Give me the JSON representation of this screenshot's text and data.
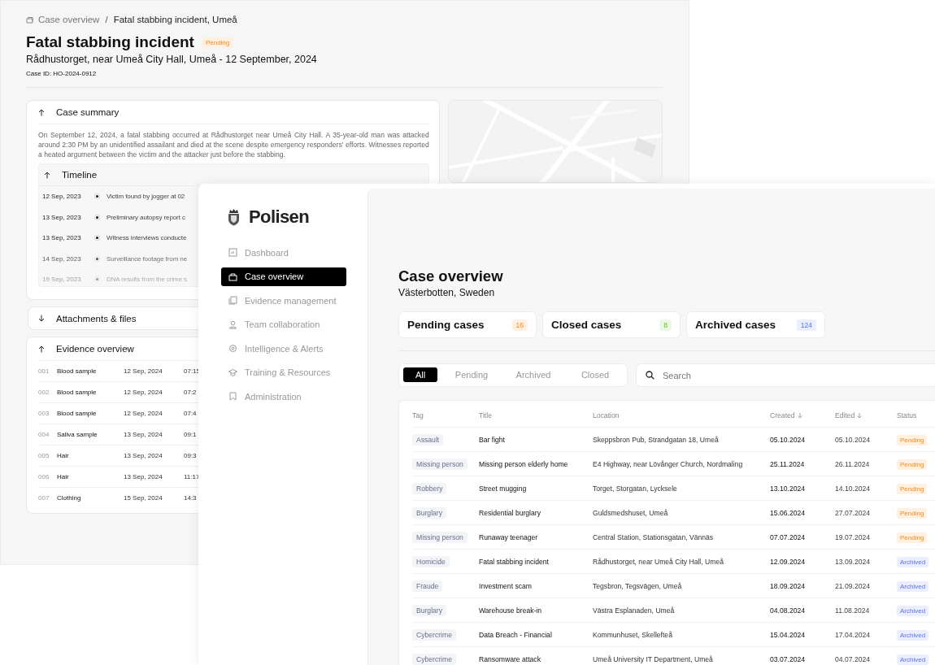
{
  "case_window": {
    "breadcrumb": {
      "parent": "Case overview",
      "separator": "/",
      "current": "Fatal stabbing incident, Umeå"
    },
    "title": "Fatal stabbing incident",
    "status": {
      "label": "Pending",
      "kind": "pending"
    },
    "subtitle": "Rådhustorget, near Umeå City Hall, Umeå - 12 September, 2024",
    "case_id": "Case ID: HO-2024-0912",
    "case_summary": {
      "title": "Case summary",
      "expanded": true,
      "text": "On September 12, 2024, a fatal stabbing occurred at Rådhustorget near Umeå City Hall. A 35-year-old man was attacked around 2:30 PM by an unidentified assailant and died at the scene despite emergency responders' efforts. Witnesses reported a heated argument between the victim and the attacker just before the stabbing."
    },
    "timeline": {
      "title": "Timeline",
      "expanded": true,
      "events": [
        {
          "date": "12 Sep, 2023",
          "text": "Victim found by jogger at 02"
        },
        {
          "date": "13 Sep, 2023",
          "text": "Preliminary autopsy report c"
        },
        {
          "date": "13 Sep, 2023",
          "text": "Witness interviews conducte"
        },
        {
          "date": "14 Sep, 2023",
          "text": "Surveillance footage from ne"
        },
        {
          "date": "19 Sep, 2023",
          "text": "DNA results from the crime s"
        }
      ]
    },
    "attachments": {
      "title": "Attachments & files",
      "expanded": false
    },
    "evidence": {
      "title": "Evidence overview",
      "expanded": true,
      "rows": [
        {
          "id": "001",
          "name": "Blood sample",
          "date": "12 Sep, 2024",
          "time": "07:15"
        },
        {
          "id": "002",
          "name": "Blood sample",
          "date": "12 Sep, 2024",
          "time": "07:2"
        },
        {
          "id": "003",
          "name": "Blood sample",
          "date": "12 Sep, 2024",
          "time": "07:4"
        },
        {
          "id": "004",
          "name": "Saliva sample",
          "date": "13 Sep, 2024",
          "time": "09:1"
        },
        {
          "id": "005",
          "name": "Hair",
          "date": "13 Sep, 2024",
          "time": "09:3"
        },
        {
          "id": "006",
          "name": "Hair",
          "date": "13 Sep, 2024",
          "time": "11:17"
        },
        {
          "id": "007",
          "name": "Clothing",
          "date": "15 Sep, 2024",
          "time": "14:3"
        }
      ]
    }
  },
  "app_window": {
    "logo": "Polisen",
    "nav": [
      {
        "label": "Dashboard",
        "selected": false
      },
      {
        "label": "Case overview",
        "selected": true
      },
      {
        "label": "Evidence management",
        "selected": false
      },
      {
        "label": "Team collaboration",
        "selected": false
      },
      {
        "label": "Intelligence & Alerts",
        "selected": false
      },
      {
        "label": "Training & Resources",
        "selected": false
      },
      {
        "label": "Administration",
        "selected": false
      }
    ],
    "title": "Case overview",
    "subtitle": "Västerbotten, Sweden",
    "stats": [
      {
        "label": "Pending cases",
        "count": "16",
        "kind": "pending"
      },
      {
        "label": "Closed cases",
        "count": "8",
        "kind": "closed"
      },
      {
        "label": "Archived cases",
        "count": "124",
        "kind": "archived"
      }
    ],
    "filters": [
      {
        "label": "All",
        "selected": true
      },
      {
        "label": "Pending",
        "selected": false
      },
      {
        "label": "Archived",
        "selected": false
      },
      {
        "label": "Closed",
        "selected": false
      }
    ],
    "search": {
      "placeholder": "Search"
    },
    "table": {
      "columns": [
        {
          "label": "Tag"
        },
        {
          "label": "Title"
        },
        {
          "label": "Location"
        },
        {
          "label": "Created",
          "sorted": true
        },
        {
          "label": "Edited",
          "sorted": true
        },
        {
          "label": "Status"
        }
      ],
      "rows": [
        {
          "tag": "Assault",
          "title": "Bar fight",
          "location": "Skeppsbron Pub, Strandgatan 18, Umeå",
          "created": "05.10.2024",
          "edited": "05.10.2024",
          "status": {
            "label": "Pending",
            "kind": "pending"
          }
        },
        {
          "tag": "Missing person",
          "title": "Missing person elderly home",
          "location": "E4 Highway, near Lövånger Church, Nordmaling",
          "created": "25.11.2024",
          "edited": "26.11.2024",
          "status": {
            "label": "Pending",
            "kind": "pending"
          }
        },
        {
          "tag": "Robbery",
          "title": "Street mugging",
          "location": "Torget, Storgatan, Lycksele",
          "created": "13.10.2024",
          "edited": "14.10.2024",
          "status": {
            "label": "Pending",
            "kind": "pending"
          }
        },
        {
          "tag": "Burglary",
          "title": "Residential burglary",
          "location": "Guldsmedshuset, Umeå",
          "created": "15.06.2024",
          "edited": "27.07.2024",
          "status": {
            "label": "Pending",
            "kind": "pending"
          }
        },
        {
          "tag": "Missing person",
          "title": "Runaway teenager",
          "location": "Central Station, Stationsgatan, Vännäs",
          "created": "07.07.2024",
          "edited": "19.07.2024",
          "status": {
            "label": "Pending",
            "kind": "pending"
          }
        },
        {
          "tag": "Homicide",
          "title": "Fatal stabbing incident",
          "location": "Rådhustorget, near Umeå City Hall, Umeå",
          "created": "12.09.2024",
          "edited": "13.09.2024",
          "status": {
            "label": "Archived",
            "kind": "archived"
          }
        },
        {
          "tag": "Fraude",
          "title": "Investment scam",
          "location": "Tegsbron, Tegsvägen, Umeå",
          "created": "18.09.2024",
          "edited": "21.09.2024",
          "status": {
            "label": "Archived",
            "kind": "archived"
          }
        },
        {
          "tag": "Burglary",
          "title": "Warehouse break-in",
          "location": "Västra Esplanaden, Umeå",
          "created": "04.08.2024",
          "edited": "11.08.2024",
          "status": {
            "label": "Archived",
            "kind": "archived"
          }
        },
        {
          "tag": "Cybercrime",
          "title": "Data Breach - Financial",
          "location": "Kommunhuset, Skellefteå",
          "created": "15.04.2024",
          "edited": "17.04.2024",
          "status": {
            "label": "Archived",
            "kind": "archived"
          }
        },
        {
          "tag": "Cybercrime",
          "title": "Ransomware attack",
          "location": "Umeå University IT Department, Umeå",
          "created": "03.07.2024",
          "edited": "04.07.2024",
          "status": {
            "label": "Archived",
            "kind": "archived"
          }
        }
      ]
    }
  }
}
